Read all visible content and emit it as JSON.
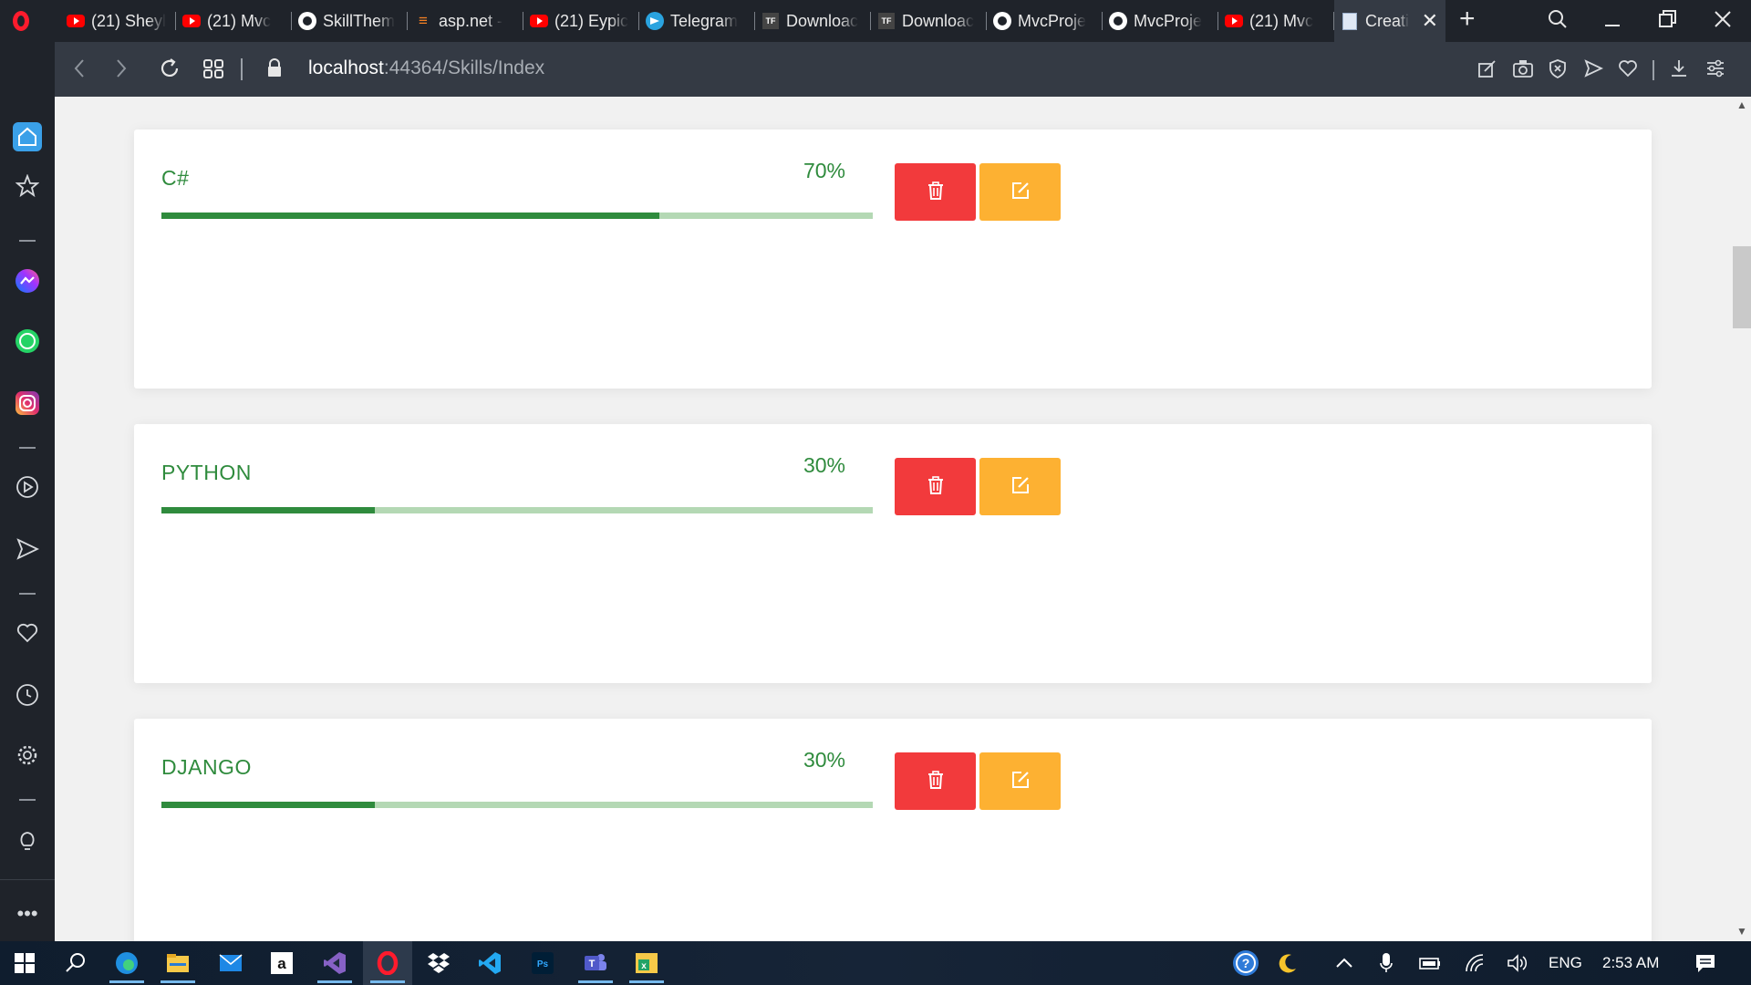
{
  "browser": {
    "tabs": [
      {
        "icon": "youtube-icon",
        "title": "(21) Sheyl"
      },
      {
        "icon": "youtube-icon",
        "title": "(21) Mvc"
      },
      {
        "icon": "github-icon",
        "title": "SkillThem"
      },
      {
        "icon": "stackoverflow-icon",
        "title": "asp.net -"
      },
      {
        "icon": "youtube-icon",
        "title": "(21) Eypic"
      },
      {
        "icon": "telegram-icon",
        "title": "Telegram"
      },
      {
        "icon": "tf-icon",
        "title": "Downloac"
      },
      {
        "icon": "tf-icon",
        "title": "Downloac"
      },
      {
        "icon": "github-icon",
        "title": "MvcProje"
      },
      {
        "icon": "github-icon",
        "title": "MvcProje"
      },
      {
        "icon": "youtube-icon",
        "title": "(21) Mvc"
      },
      {
        "icon": "document-icon",
        "title": "Creati",
        "active": true
      }
    ],
    "url_host": "localhost",
    "url_path": ":44364/Skills/Index"
  },
  "skills": [
    {
      "name": "C#",
      "percent_label": "70%",
      "percent": 70
    },
    {
      "name": "PYTHON",
      "percent_label": "30%",
      "percent": 30
    },
    {
      "name": "DJANGO",
      "percent_label": "30%",
      "percent": 30
    }
  ],
  "colors": {
    "skill_green": "#2f8b3d",
    "track_green": "#b4d8b4",
    "delete_red": "#f23a3c",
    "edit_orange": "#fdb132"
  },
  "taskbar": {
    "language": "ENG",
    "time": "2:53 AM"
  }
}
